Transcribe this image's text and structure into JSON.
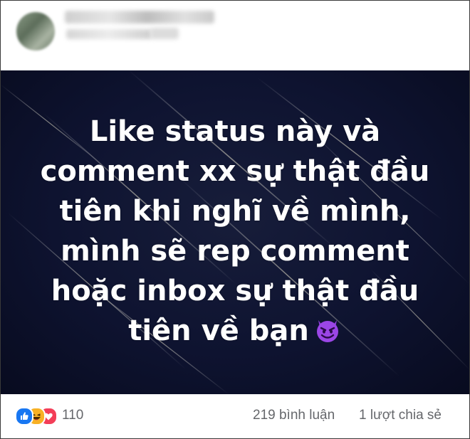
{
  "post": {
    "status_text": "Like status này và\ncomment xx sự thật đầu\ntiên khi nghĩ về mình,\nmình sẽ rep comment\nhoặc inbox sự thật đầu\ntiên về bạn",
    "trailing_emoji": "smiling-devil-icon",
    "background_color": "#0e1330",
    "text_color": "#ffffff"
  },
  "footer": {
    "reactions": [
      "like-icon",
      "haha-icon",
      "love-icon"
    ],
    "reaction_count": "110",
    "comments": "219 bình luận",
    "shares": "1 lượt chia sẻ",
    "colors": {
      "like": "#1877f2",
      "haha": "#f7b125",
      "love": "#f33e58",
      "meta_text": "#65676b"
    }
  }
}
